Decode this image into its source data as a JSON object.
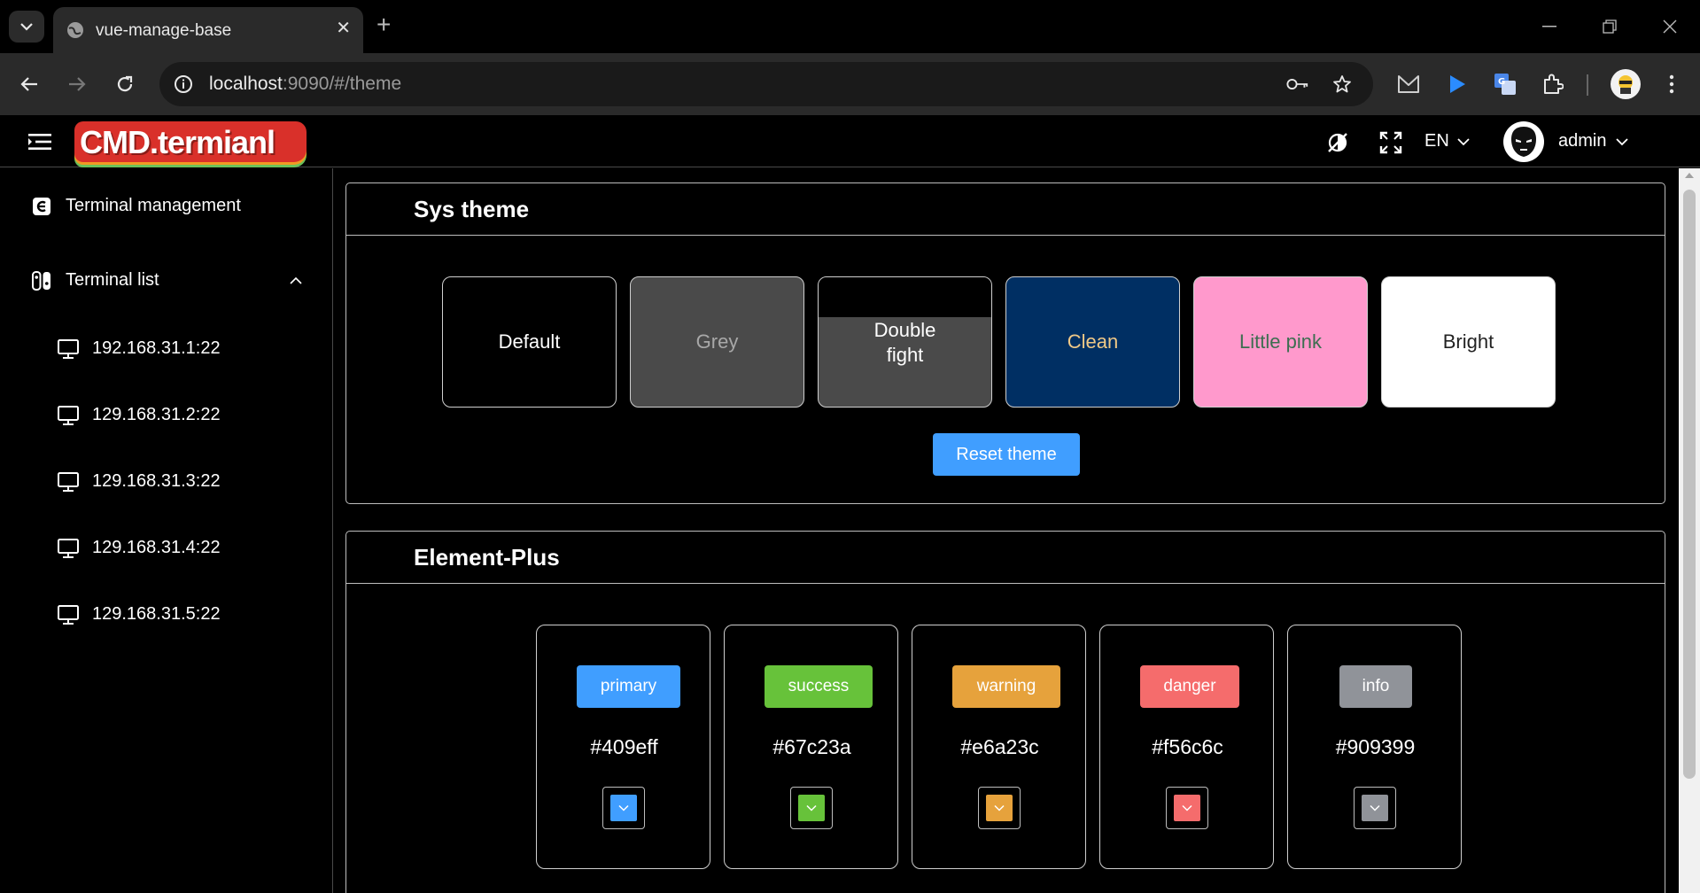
{
  "browser": {
    "tab_title": "vue-manage-base",
    "url_host": "localhost",
    "url_rest": ":9090/#/theme",
    "close_tab_glyph": "✕",
    "new_tab_glyph": "+"
  },
  "app": {
    "logo_text": "CMD.termianl",
    "language": "EN",
    "username": "admin"
  },
  "sidebar": {
    "items": [
      {
        "label": "Terminal management",
        "icon": "terminal-management-icon"
      },
      {
        "label": "Terminal list",
        "icon": "terminal-list-icon",
        "expanded": true
      }
    ],
    "terminals": [
      {
        "label": "192.168.31.1:22"
      },
      {
        "label": "129.168.31.2:22"
      },
      {
        "label": "129.168.31.3:22"
      },
      {
        "label": "129.168.31.4:22"
      },
      {
        "label": "129.168.31.5:22"
      }
    ]
  },
  "sys_theme": {
    "title": "Sys theme",
    "themes": [
      {
        "label": "Default",
        "bg": "#000000",
        "fg": "#ffffff"
      },
      {
        "label": "Grey",
        "bg": "#4a4a4a",
        "fg": "#a8a8a8"
      },
      {
        "label": "Double fight",
        "bg": "#4a4a4a",
        "fg": "#ffffff",
        "top_band": "#000000"
      },
      {
        "label": "Clean",
        "bg": "#002f63",
        "fg": "#f0c987"
      },
      {
        "label": "Little pink",
        "bg": "#ff99cc",
        "fg": "#3c6e50"
      },
      {
        "label": "Bright",
        "bg": "#ffffff",
        "fg": "#222222"
      }
    ],
    "reset_label": "Reset theme"
  },
  "element_plus": {
    "title": "Element-Plus",
    "colors": [
      {
        "name": "primary",
        "hex": "#409eff"
      },
      {
        "name": "success",
        "hex": "#67c23a"
      },
      {
        "name": "warning",
        "hex": "#e6a23c"
      },
      {
        "name": "danger",
        "hex": "#f56c6c"
      },
      {
        "name": "info",
        "hex": "#909399"
      }
    ]
  }
}
